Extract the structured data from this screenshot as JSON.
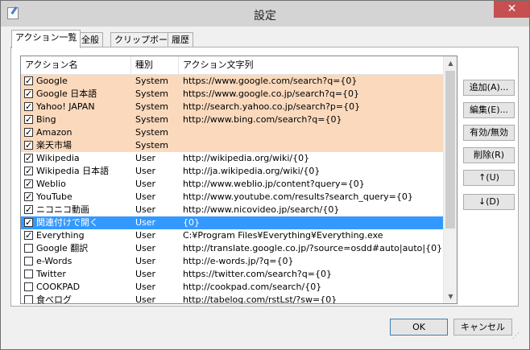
{
  "window": {
    "title": "設定",
    "close_label": "✕"
  },
  "tabs": [
    {
      "label": "アクション一覧",
      "active": true
    },
    {
      "label": "全般",
      "active": false
    },
    {
      "label": "クリップボード",
      "active": false
    },
    {
      "label": "履歴",
      "active": false
    }
  ],
  "list": {
    "columns": [
      "アクション名",
      "種別",
      "アクション文字列"
    ],
    "rows": [
      {
        "checked": true,
        "name": "Google",
        "kind": "System",
        "action": "https://www.google.com/search?q={0}",
        "style": "system"
      },
      {
        "checked": true,
        "name": "Google 日本語",
        "kind": "System",
        "action": "https://www.google.co.jp/search?q={0}",
        "style": "system"
      },
      {
        "checked": true,
        "name": "Yahoo! JAPAN",
        "kind": "System",
        "action": "http://search.yahoo.co.jp/search?p={0}",
        "style": "system"
      },
      {
        "checked": true,
        "name": "Bing",
        "kind": "System",
        "action": "http://www.bing.com/search?q={0}",
        "style": "system"
      },
      {
        "checked": true,
        "name": "Amazon",
        "kind": "System",
        "action": "",
        "style": "system"
      },
      {
        "checked": true,
        "name": "楽天市場",
        "kind": "System",
        "action": "",
        "style": "system"
      },
      {
        "checked": true,
        "name": "Wikipedia",
        "kind": "User",
        "action": "http://wikipedia.org/wiki/{0}",
        "style": ""
      },
      {
        "checked": true,
        "name": "Wikipedia 日本語",
        "kind": "User",
        "action": "http://ja.wikipedia.org/wiki/{0}",
        "style": ""
      },
      {
        "checked": true,
        "name": "Weblio",
        "kind": "User",
        "action": "http://www.weblio.jp/content?query={0}",
        "style": ""
      },
      {
        "checked": true,
        "name": "YouTube",
        "kind": "User",
        "action": "http://www.youtube.com/results?search_query={0}",
        "style": ""
      },
      {
        "checked": true,
        "name": "ニコニコ動画",
        "kind": "User",
        "action": "http://www.nicovideo.jp/search/{0}",
        "style": ""
      },
      {
        "checked": true,
        "name": "関連付けで開く",
        "kind": "User",
        "action": "{0}",
        "style": "selected"
      },
      {
        "checked": true,
        "name": "Everything",
        "kind": "User",
        "action": "C:¥Program Files¥Everything¥Everything.exe",
        "style": ""
      },
      {
        "checked": false,
        "name": "Google 翻訳",
        "kind": "User",
        "action": "http://translate.google.co.jp/?source=osdd#auto|auto|{0}",
        "style": ""
      },
      {
        "checked": false,
        "name": "e-Words",
        "kind": "User",
        "action": "http://e-words.jp/?q={0}",
        "style": ""
      },
      {
        "checked": false,
        "name": "Twitter",
        "kind": "User",
        "action": "https://twitter.com/search?q={0}",
        "style": ""
      },
      {
        "checked": false,
        "name": "COOKPAD",
        "kind": "User",
        "action": "http://cookpad.com/search/{0}",
        "style": ""
      },
      {
        "checked": false,
        "name": "食べログ",
        "kind": "User",
        "action": "http://tabelog.com/rstLst/?sw={0}",
        "style": ""
      }
    ]
  },
  "buttons": {
    "add": "追加(A)...",
    "edit": "編集(E)...",
    "toggle": "有効/無効",
    "delete": "削除(R)",
    "up": "↑(U)",
    "down": "↓(D)",
    "ok": "OK",
    "cancel": "キャンセル"
  },
  "colors": {
    "system_row": "#fad9bd",
    "selected_row": "#3399ff",
    "close_button": "#c74f4f"
  }
}
